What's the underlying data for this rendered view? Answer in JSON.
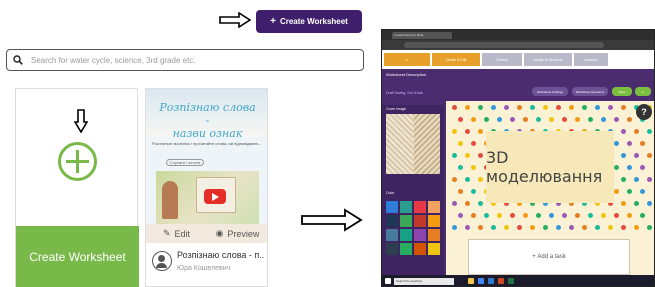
{
  "top": {
    "create_label": "Create Worksheet"
  },
  "search": {
    "placeholder": "Search for water cycle, science, 3rd grade etc."
  },
  "create_card": {
    "label": "Create Worksheet"
  },
  "worksheet_card": {
    "thumb_title": "Розпізнаю слова -\nназви ознак",
    "thumb_desc": "Розгляньте малюнок і прочитайте слова, які відповідають...",
    "thumb_pill": "Слухати і читати",
    "edit_label": "Edit",
    "preview_label": "Preview",
    "title": "Розпізнаю слова - п...",
    "author": "Юра Кошелевич"
  },
  "editor": {
    "tab_title": "Liveworksheets | Beta",
    "steps": [
      "Create & Edit",
      "Review",
      "Assign to Students",
      "Answers"
    ],
    "description": "Worksheet Description",
    "draft": "Draft Saving, Got It Ade",
    "btn_worksheet": "Worksheet Settings",
    "btn_questions": "Worksheet Questions",
    "btn_save": "Save",
    "cover_label": "Cover Image",
    "color_label": "Color",
    "canvas_title": "3D моделювання",
    "add_task": "Add a task",
    "help": "?",
    "taskbar_search": "Search for anything"
  },
  "colors": {
    "purple": "#3f1f6b",
    "green": "#78b94a",
    "editor_bg": "#4b2c6f",
    "canvas_bg": "#fbf2d6"
  }
}
